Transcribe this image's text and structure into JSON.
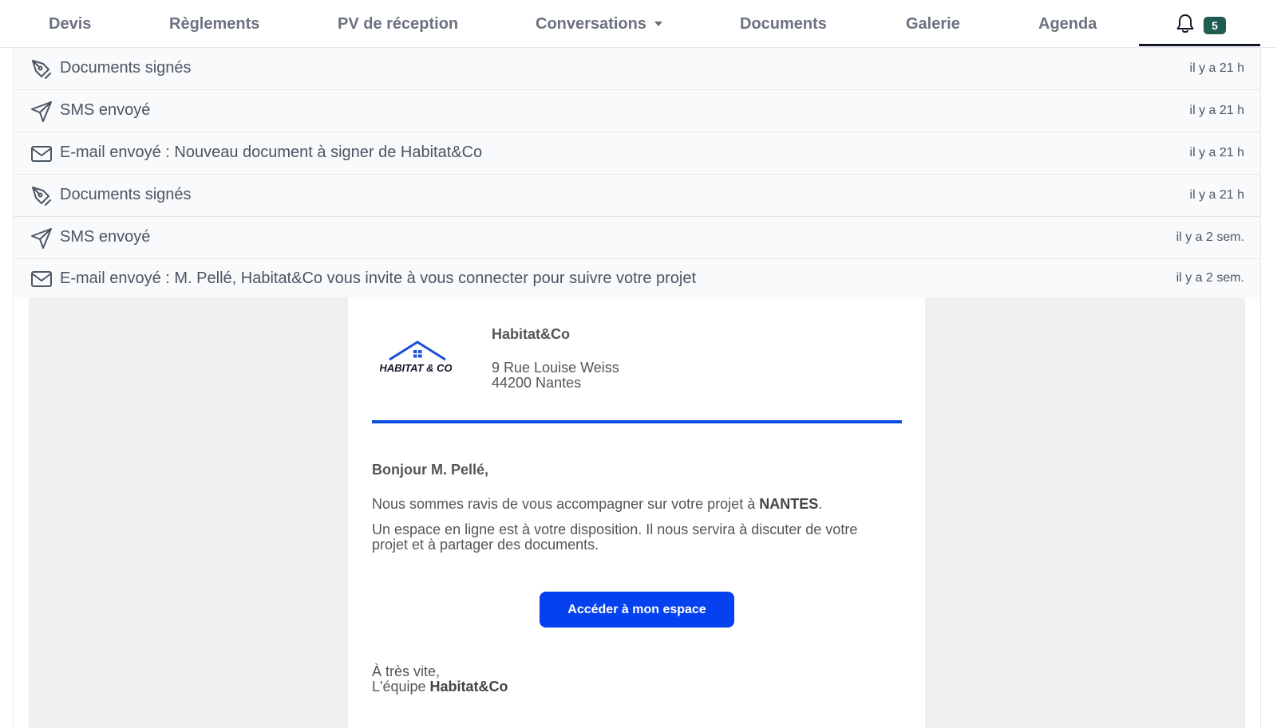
{
  "tabs": [
    {
      "label": "Devis"
    },
    {
      "label": "Règlements"
    },
    {
      "label": "PV de réception"
    },
    {
      "label": "Conversations"
    },
    {
      "label": "Documents"
    },
    {
      "label": "Galerie"
    },
    {
      "label": "Agenda"
    }
  ],
  "notifications": {
    "icon": "bell-icon",
    "count": "5"
  },
  "activity": [
    {
      "icon": "pen-nib-icon",
      "label": "Documents signés",
      "time": "il y a 21 h"
    },
    {
      "icon": "paper-plane-icon",
      "label": "SMS envoyé",
      "time": "il y a 21 h"
    },
    {
      "icon": "envelope-icon",
      "label": "E-mail envoyé : Nouveau document à signer de Habitat&Co",
      "time": "il y a 21 h"
    },
    {
      "icon": "pen-nib-icon",
      "label": "Documents signés",
      "time": "il y a 21 h"
    },
    {
      "icon": "paper-plane-icon",
      "label": "SMS envoyé",
      "time": "il y a 2 sem."
    },
    {
      "icon": "envelope-icon",
      "label": "E-mail envoyé : M. Pellé, Habitat&Co vous invite à vous connecter pour suivre votre projet",
      "time": "il y a 2 sem."
    }
  ],
  "email": {
    "logo_text": "HABITAT & CO",
    "company": "Habitat&Co",
    "address_line1": "9 Rue Louise Weiss",
    "address_line2": "44200 Nantes",
    "greeting": "Bonjour M. Pellé,",
    "para1_text": "Nous sommes ravis de vous accompagner sur votre projet à ",
    "para1_city": "NANTES",
    "para1_end": ".",
    "para2_line1": "Un espace en ligne est à votre disposition. Il nous servira à discuter de votre",
    "para2_line2": "projet et à partager des documents.",
    "cta": "Accéder à mon espace",
    "signoff_line1": "À très vite,",
    "signoff_prefix": "L'équipe ",
    "signoff_company": "Habitat&Co"
  },
  "colors": {
    "accent_blue": "#0641f0",
    "badge_green": "#1f5c52",
    "row_bg": "#f9fafb",
    "email_bg": "#efefef"
  }
}
